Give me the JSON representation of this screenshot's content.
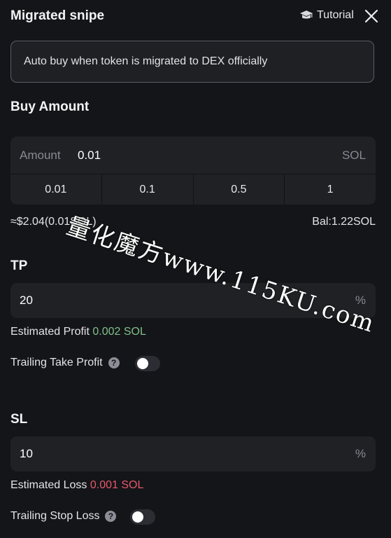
{
  "header": {
    "title": "Migrated snipe",
    "tutorial_label": "Tutorial"
  },
  "info": {
    "text": "Auto buy when token is migrated to DEX officially"
  },
  "buy": {
    "section_title": "Buy Amount",
    "amount_label": "Amount",
    "amount_value": "0.01",
    "unit": "SOL",
    "presets": [
      "0.01",
      "0.1",
      "0.5",
      "1"
    ],
    "usd_estimate": "≈$2.04(0.01SOL)",
    "balance": "Bal:1.22SOL"
  },
  "tp": {
    "section_title": "TP",
    "value": "20",
    "unit": "%",
    "estimate_label": "Estimated Profit",
    "estimate_value": "0.002 SOL",
    "trailing_label": "Trailing Take Profit",
    "trailing_on": false
  },
  "sl": {
    "section_title": "SL",
    "value": "10",
    "unit": "%",
    "estimate_label": "Estimated Loss",
    "estimate_value": "0.001 SOL",
    "trailing_label": "Trailing Stop Loss",
    "trailing_on": false
  },
  "watermark": "量化魔方www.115KU.com",
  "colors": {
    "background": "#141518",
    "profit": "#7fc18a",
    "loss": "#e5586b",
    "card": "#1f2125"
  }
}
